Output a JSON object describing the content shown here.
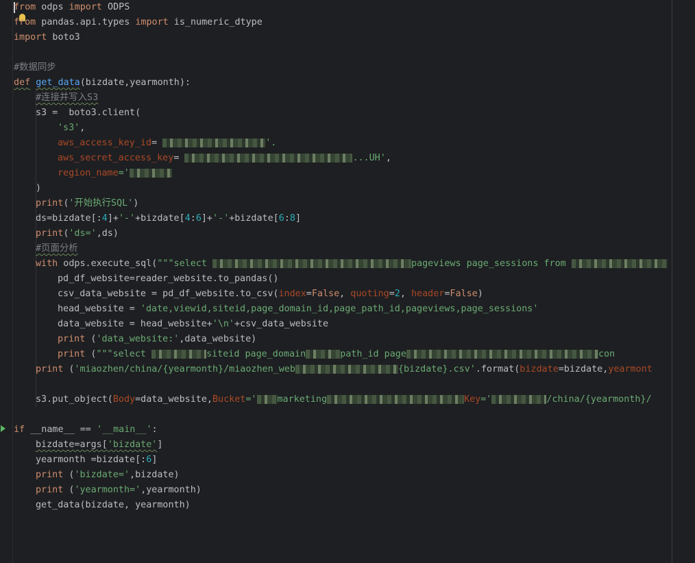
{
  "lines": {
    "l1": {
      "a": "from",
      "b": " odps ",
      "c": "import",
      "d": " ODPS"
    },
    "l2": {
      "a": "from",
      "b": " pandas.api.types ",
      "c": "import",
      "d": " is_numeric_dtype"
    },
    "l3": {
      "a": "import",
      "b": " boto3"
    },
    "l5": {
      "a": "#数据同步"
    },
    "l6": {
      "a": "def",
      "b": " ",
      "c": "get_data",
      "d": "(bizdate,yearmonth):"
    },
    "l7": {
      "a": "#连接并写入S3"
    },
    "l8": {
      "a": "s3 = ",
      "b": "boto3.client("
    },
    "l9": {
      "a": "'s3'",
      "b": ","
    },
    "l10": {
      "a": "aws_access_key_id",
      "b": "= ",
      "c": "'",
      "d": "'."
    },
    "l11": {
      "a": "aws_secret_access_key",
      "b": "= ",
      "c": "...UH'",
      "d": ","
    },
    "l12": {
      "a": "region_name",
      "b": "='"
    },
    "l13": {
      "a": ")"
    },
    "l14": {
      "a": "print",
      "b": "(",
      "c": "'开始执行SQL'",
      "d": ")"
    },
    "l15": {
      "a": "ds=bizdate[:",
      "b": "4",
      "c": "]+",
      "d": "'-'",
      "e": "+bizdate[",
      "f": "4",
      "g": ":",
      "h": "6",
      "i": "]+",
      "j": "'-'",
      "k": "+bizdate[",
      "l": "6",
      "m": ":",
      "n": "8",
      "o": "]"
    },
    "l16": {
      "a": "print",
      "b": "(",
      "c": "'ds='",
      "d": ",ds)"
    },
    "l17": {
      "a": "#页面分析"
    },
    "l18": {
      "a": "with",
      "b": " odps.execute_sql(",
      "c": "\"\"\"select ",
      "d": "pageviews page_sessions from "
    },
    "l19": {
      "a": "pd_df_website=reader_website.to_pandas()"
    },
    "l20": {
      "a": "csv_data_website = pd_df_website.to_csv(",
      "b": "index",
      "c": "=",
      "d": "False",
      "e": ", ",
      "f": "quoting",
      "g": "=",
      "h": "2",
      "i": ", ",
      "j": "header",
      "k": "=",
      "l": "False",
      "m": ")"
    },
    "l21": {
      "a": "head_website = ",
      "b": "'date,viewid,siteid,page_domain_id,page_path_id,pageviews,page_sessions'"
    },
    "l22": {
      "a": "data_website = head_website+",
      "b": "'\\n'",
      "c": "+csv_data_website"
    },
    "l23": {
      "a": "print",
      "b": " (",
      "c": "'data_website:'",
      "d": ",data_website)"
    },
    "l24": {
      "a": "print",
      "b": " (",
      "c": "\"\"\"select ",
      "d": "siteid page_domain",
      "e": "path_id page",
      "f": "con"
    },
    "l25": {
      "a": "print",
      "b": " (",
      "c": "'miaozhen/china/{yearmonth}/miaozhen_web",
      "d": "{bizdate}.csv'",
      "e": ".format(",
      "f": "bizdate",
      "g": "=bizdate,",
      "h": "yearmont"
    },
    "l27": {
      "a": "s3.put_object(",
      "b": "Body",
      "c": "=data_website,",
      "d": "Bucket",
      "e": "='",
      "f": "marketing",
      "g": "Key",
      "h": "='",
      "i": "/china/{yearmonth}/"
    },
    "l29": {
      "a": "if",
      "b": " __name__ == ",
      "c": "'__main__'",
      "d": ":"
    },
    "l30": {
      "a": "bizdate=args[",
      "b": "'bizdate'",
      "c": "]"
    },
    "l31": {
      "a": "yearmonth =bizdate[:",
      "b": "6",
      "c": "]"
    },
    "l32": {
      "a": "print",
      "b": " (",
      "c": "'bizdate='",
      "d": ",bizdate)"
    },
    "l33": {
      "a": "print",
      "b": " (",
      "c": "'yearmonth='",
      "d": ",yearmonth)"
    },
    "l34": {
      "a": "get_data(bizdate, yearmonth)"
    }
  },
  "colors": {
    "background": "#1e1f22",
    "keyword": "#cf8e6d",
    "function": "#56a8f5",
    "string": "#6aab73",
    "number": "#2aacb8",
    "comment": "#7a7e85",
    "named_param": "#aa4926",
    "default_text": "#bcbec4"
  },
  "icons": [
    "caret",
    "lightbulb-icon",
    "run-arrow-icon"
  ]
}
